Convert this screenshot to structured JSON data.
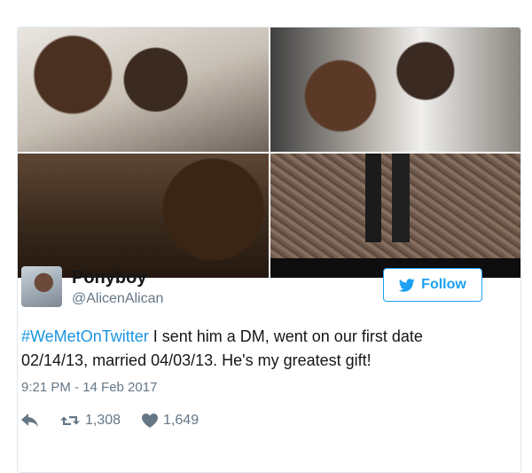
{
  "tweet": {
    "display_name": "Ponyboy",
    "handle": "@AlicenAlican",
    "follow_label": "Follow",
    "hashtag": "#WeMetOnTwitter",
    "text": " I sent him a DM, went on our first date 02/14/13, married 04/03/13. He's my greatest gift!",
    "timestamp": "9:21 PM - 14 Feb 2017",
    "retweet_count": "1,308",
    "like_count": "1,649"
  },
  "photos": [
    {
      "name": "photo-1"
    },
    {
      "name": "photo-2"
    },
    {
      "name": "photo-3"
    },
    {
      "name": "photo-4"
    }
  ],
  "icons": {
    "bird": "twitter-bird-icon",
    "reply": "reply-icon",
    "retweet": "retweet-icon",
    "like": "heart-icon"
  },
  "colors": {
    "accent": "#1da1f2",
    "hashtag": "#1b95e0",
    "muted": "#657786",
    "text": "#14171a"
  }
}
